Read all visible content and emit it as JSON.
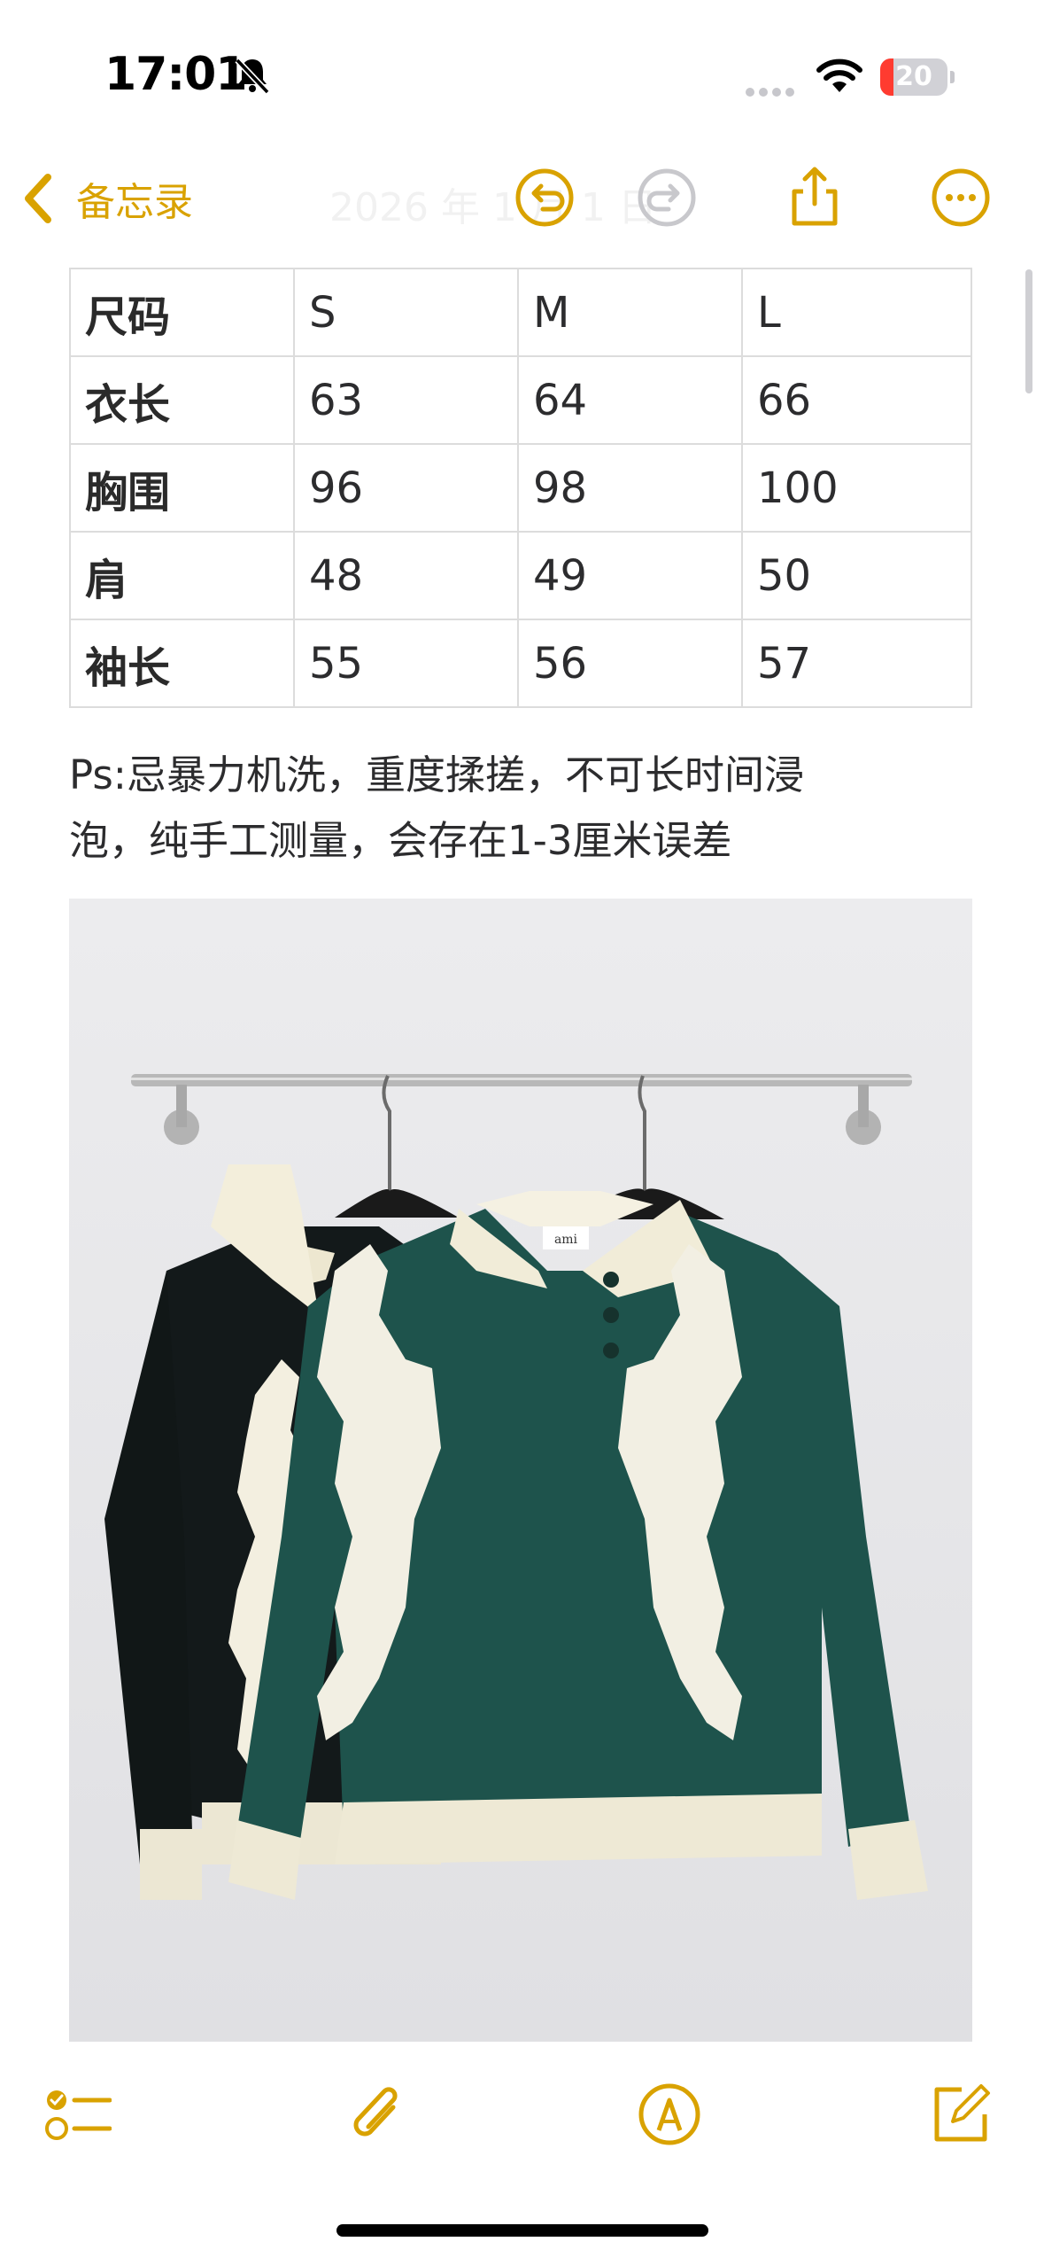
{
  "status_bar": {
    "time": "17:01",
    "battery_level": "20",
    "battery_percent": 0.2,
    "icons": [
      "bell-slash-icon",
      "signal-dots-icon",
      "wifi-icon",
      "battery-icon"
    ]
  },
  "nav": {
    "back_label": "备忘录",
    "faded_title": "2026 年 1 月 1 日",
    "icons": [
      "chevron-left-icon",
      "undo-icon",
      "redo-icon",
      "share-icon",
      "more-icon"
    ]
  },
  "table": {
    "header": [
      "尺码",
      "S",
      "M",
      "L"
    ],
    "rows": [
      [
        "衣长",
        "63",
        "64",
        "66"
      ],
      [
        "胸围",
        "96",
        "98",
        "100"
      ],
      [
        "肩",
        "48",
        "49",
        "50"
      ],
      [
        "袖长",
        "55",
        "56",
        "57"
      ]
    ]
  },
  "note": {
    "line1": "Ps:忌暴力机洗，重度揉搓，不可长时间浸",
    "line2": "泡，纯手工测量，会存在1-3厘米误差"
  },
  "photo": {
    "label": "ami"
  },
  "toolbar": {
    "icons": [
      "checklist-icon",
      "paperclip-icon",
      "markup-pen-icon",
      "compose-icon"
    ]
  },
  "colors": {
    "accent": "#D9A200",
    "sweater_dark": "#13191A",
    "sweater_green": "#1E534C",
    "cream": "#EFEAD6"
  }
}
